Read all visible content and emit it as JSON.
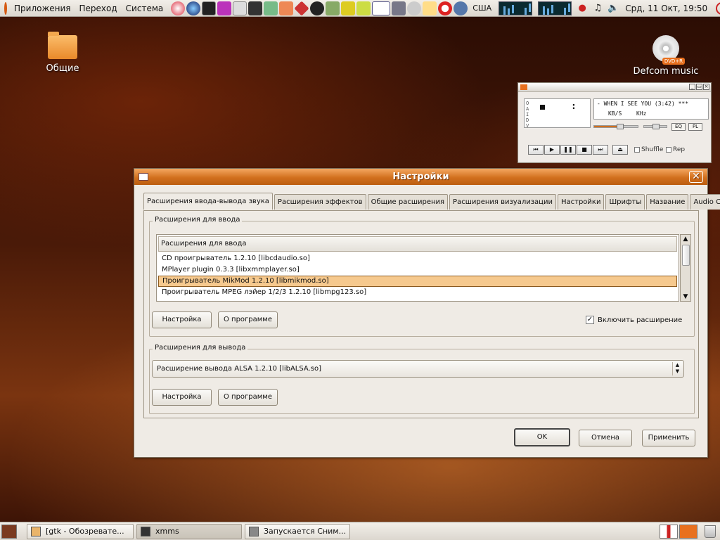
{
  "top_panel": {
    "menus": [
      "Приложения",
      "Переход",
      "Система"
    ],
    "locale": "США",
    "clock": "Срд, 11 Окт, 19:50"
  },
  "desktop": {
    "icons": [
      {
        "label": "Общие"
      },
      {
        "label": "Defcom music",
        "badge": "DVD+R"
      }
    ]
  },
  "xmms": {
    "side_letters": "O\nA\nI\nD\nV",
    "time_colon": ":",
    "song": "- WHEN I SEE YOU (3:42)  ***",
    "kbs": "KB/S",
    "khz": "KHz",
    "eq_label": "EQ",
    "pl_label": "PL",
    "shuffle_label": "Shuffle",
    "repeat_label": "Rep",
    "volume_fraction": 0.6
  },
  "dialog": {
    "title": "Настройки",
    "tabs": [
      "Расширения ввода-вывода звука",
      "Расширения эффектов",
      "Общие расширения",
      "Расширения визуализации",
      "Настройки",
      "Шрифты",
      "Название",
      "Audio CD"
    ],
    "active_tab": 0,
    "input_section": {
      "label": "Расширения для ввода",
      "column_header": "Расширения для ввода",
      "items": [
        "CD проигрыватель 1.2.10   [libcdaudio.so]",
        "MPlayer plugin 0.3.3   [libxmmplayer.so]",
        "Проигрыватель MikMod 1.2.10   [libmikmod.so]",
        "Проигрыватель MPEG лэйер 1/2/3 1.2.10   [libmpg123.so]"
      ],
      "selected_index": 2,
      "configure_button": "Настройка",
      "about_button": "О программе",
      "enable_label": "Включить расширение",
      "enable_checked": true
    },
    "output_section": {
      "label": "Расширения для вывода",
      "selected": "Расширение вывода ALSA 1.2.10   [libALSA.so]",
      "configure_button": "Настройка",
      "about_button": "О программе"
    },
    "ok_button": "OK",
    "cancel_button": "Отмена",
    "apply_button": "Применить"
  },
  "taskbar": {
    "tasks": [
      {
        "label": "[gtk - Обозревате...",
        "active": false
      },
      {
        "label": "xmms",
        "active": true
      },
      {
        "label": "Запускается Сним...",
        "active": false
      }
    ]
  },
  "colors": {
    "accent": "#d2701e",
    "selection": "#f6c98e"
  }
}
